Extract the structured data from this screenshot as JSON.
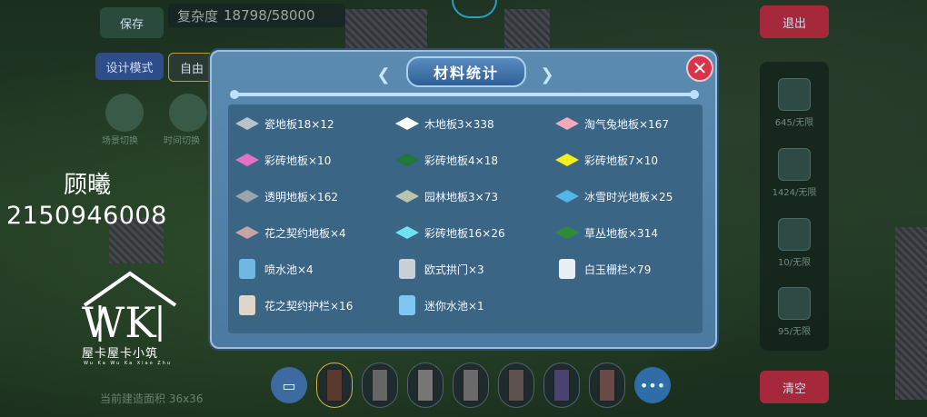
{
  "game_ui": {
    "top_left_button": "保存",
    "complexity_label": "复杂度",
    "complexity_value": "18798/58000",
    "exit_button": "退出",
    "mode_button": "设计模式",
    "free_button": "自由",
    "scene_switch": "场景切换",
    "time_switch": "时间切换",
    "clear_button": "清空",
    "current_area": "当前建造面积 36x36",
    "right_panel": [
      {
        "text": "645/无限"
      },
      {
        "text": "1424/无限"
      },
      {
        "text": "10/无限"
      },
      {
        "text": "95/无限"
      }
    ]
  },
  "watermark": {
    "name": "顾曦",
    "number": "2150946008",
    "logo_letters": "WK",
    "logo_text": "屋卡屋卡小筑",
    "logo_sub": "Wu Ka Wu Ka Xiao Zhu"
  },
  "dialog": {
    "title": "材料统计",
    "close_symbol": "✕",
    "columns": [
      [
        {
          "label": "瓷地板18×12",
          "icon": "tile-porcelain",
          "color": "#b7c2c9"
        },
        {
          "label": "彩砖地板×10",
          "icon": "tile-pink",
          "color": "#e76fc8"
        },
        {
          "label": "透明地板×162",
          "icon": "tile-glass",
          "color": "#9aa5ad"
        },
        {
          "label": "花之契约地板×4",
          "icon": "tile-flower",
          "color": "#c9a1a8"
        },
        {
          "label": "喷水池×4",
          "icon": "fountain-icon",
          "color": "#6fb6e0"
        },
        {
          "label": "花之契约护栏×16",
          "icon": "railing-icon",
          "color": "#e0d6c8"
        }
      ],
      [
        {
          "label": "木地板3×338",
          "icon": "tile-wood",
          "color": "#ffffff"
        },
        {
          "label": "彩砖地板4×18",
          "icon": "tile-darkgreen",
          "color": "#1f7a33"
        },
        {
          "label": "园林地板3×73",
          "icon": "tile-garden",
          "color": "#b9c4b0"
        },
        {
          "label": "彩砖地板16×26",
          "icon": "tile-cyan",
          "color": "#6fe3ee"
        },
        {
          "label": "欧式拱门×3",
          "icon": "arch-icon",
          "color": "#c9d0d6"
        },
        {
          "label": "迷你水池×1",
          "icon": "pool-icon",
          "color": "#7ec7f0"
        }
      ],
      [
        {
          "label": "淘气兔地板×167",
          "icon": "tile-rabbit",
          "color": "#f2a9b9"
        },
        {
          "label": "彩砖地板7×10",
          "icon": "tile-yellow",
          "color": "#f4ef1c"
        },
        {
          "label": "冰雪时光地板×25",
          "icon": "tile-ice",
          "color": "#53b6e8"
        },
        {
          "label": "草丛地板×314",
          "icon": "tile-grass",
          "color": "#2f8a35"
        },
        {
          "label": "白玉栅栏×79",
          "icon": "fence-icon",
          "color": "#e8eef2"
        }
      ]
    ]
  }
}
